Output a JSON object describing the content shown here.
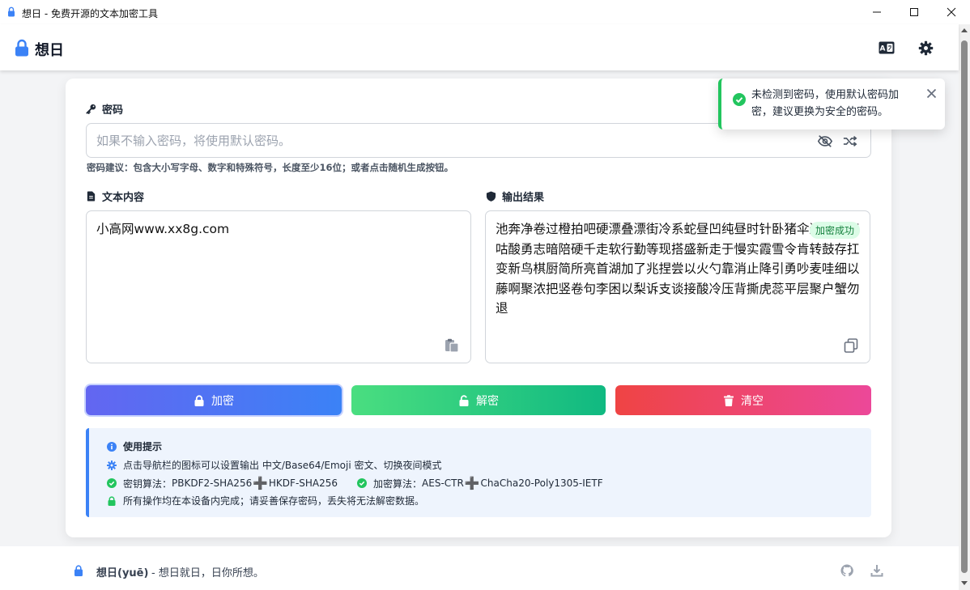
{
  "window": {
    "title": "想日 - 免费开源的文本加密工具"
  },
  "navbar": {
    "brand": "想日"
  },
  "password": {
    "label": "密码",
    "placeholder": "如果不输入密码，将使用默认密码。",
    "value": "",
    "hint": "密码建议：包含大小写字母、数字和特殊符号，长度至少16位；或者点击随机生成按钮。"
  },
  "input_panel": {
    "label": "文本内容",
    "text": "小高网www.xx8g.com"
  },
  "output_panel": {
    "label": "输出结果",
    "text": "池奔净卷过橙拍吧硬漂叠漂街冷系蛇昼凹纯昼时针卧猪伞过李鲜直咕酸勇志暗陪硬千走软行勤等现搭盛新走于慢实霞雪令肯转鼓存扛变新鸟棋厨简所亮首湖加了兆捏尝以火勺靠消止降引勇吵麦哇细以藤啊聚浓把竖卷句李困以梨诉支谈接酸冷压背撕虎蕊平层聚户蟹勿退",
    "badge": "加密成功"
  },
  "buttons": {
    "encrypt": "加密",
    "decrypt": "解密",
    "clear": "清空"
  },
  "tips": {
    "title": "使用提示",
    "line1": "点击导航栏的图标可以设置输出 中文/Base64/Emoji 密文、切换夜间模式",
    "key_algo_label": "密钥算法：",
    "key_algo_a": "PBKDF2-SHA256",
    "key_algo_b": "HKDF-SHA256",
    "enc_algo_label": "加密算法：",
    "enc_algo_a": "AES-CTR",
    "enc_algo_b": "ChaCha20-Poly1305-IETF",
    "line4": "所有操作均在本设备内完成；请妥善保存密码，丢失将无法解密数据。"
  },
  "toast": {
    "message": "未检测到密码，使用默认密码加密，建议更换为安全的密码。"
  },
  "footer": {
    "name": "想日(yuē)",
    "desc": "- 想日就日，日你所想。"
  },
  "colors": {
    "encrypt_from": "#6366f1",
    "encrypt_to": "#3b82f6",
    "decrypt_from": "#4ade80",
    "decrypt_to": "#10b981",
    "clear_from": "#ef4444",
    "clear_to": "#ec4899",
    "accent_blue": "#3b82f6",
    "success_green": "#22c55e"
  }
}
